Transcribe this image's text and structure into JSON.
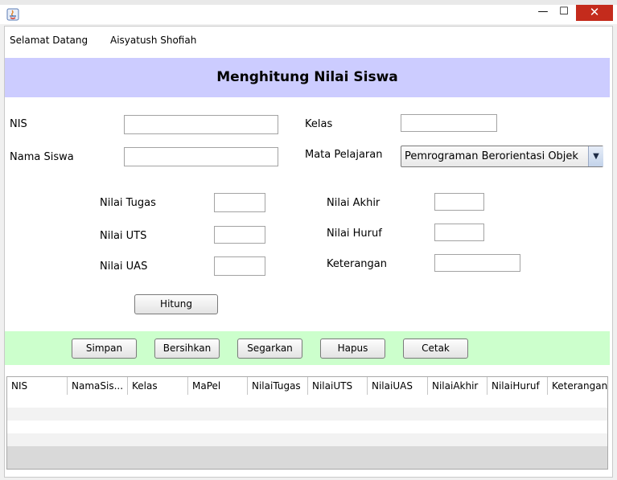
{
  "window": {
    "minimize_glyph": "—",
    "maximize_glyph": "☐",
    "close_glyph": "✕",
    "icon": "java-icon"
  },
  "welcome": {
    "greeting": "Selamat Datang",
    "user_name": "Aisyatush Shofiah"
  },
  "header": {
    "title": "Menghitung Nilai Siswa",
    "band_color": "#ccccff"
  },
  "form": {
    "nis_label": "NIS",
    "nis_value": "",
    "nama_label": "Nama Siswa",
    "nama_value": "",
    "kelas_label": "Kelas",
    "kelas_value": "",
    "mapel_label": "Mata Pelajaran",
    "mapel_selected": "Pemrograman Berorientasi Objek",
    "nilai_tugas_label": "Nilai Tugas",
    "nilai_uts_label": "Nilai UTS",
    "nilai_uas_label": "Nilai UAS",
    "nilai_akhir_label": "Nilai Akhir",
    "nilai_huruf_label": "Nilai Huruf",
    "keterangan_label": "Keterangan",
    "hitung_label": "Hitung"
  },
  "actions": {
    "band_color": "#ccffcc",
    "simpan": "Simpan",
    "bersihkan": "Bersihkan",
    "segarkan": "Segarkan",
    "hapus": "Hapus",
    "cetak": "Cetak"
  },
  "table": {
    "columns": [
      "NIS",
      "NamaSis...",
      "Kelas",
      "MaPel",
      "NilaiTugas",
      "NilaiUTS",
      "NilaiUAS",
      "NilaiAkhir",
      "NilaiHuruf",
      "Keterangan"
    ],
    "rows": []
  }
}
